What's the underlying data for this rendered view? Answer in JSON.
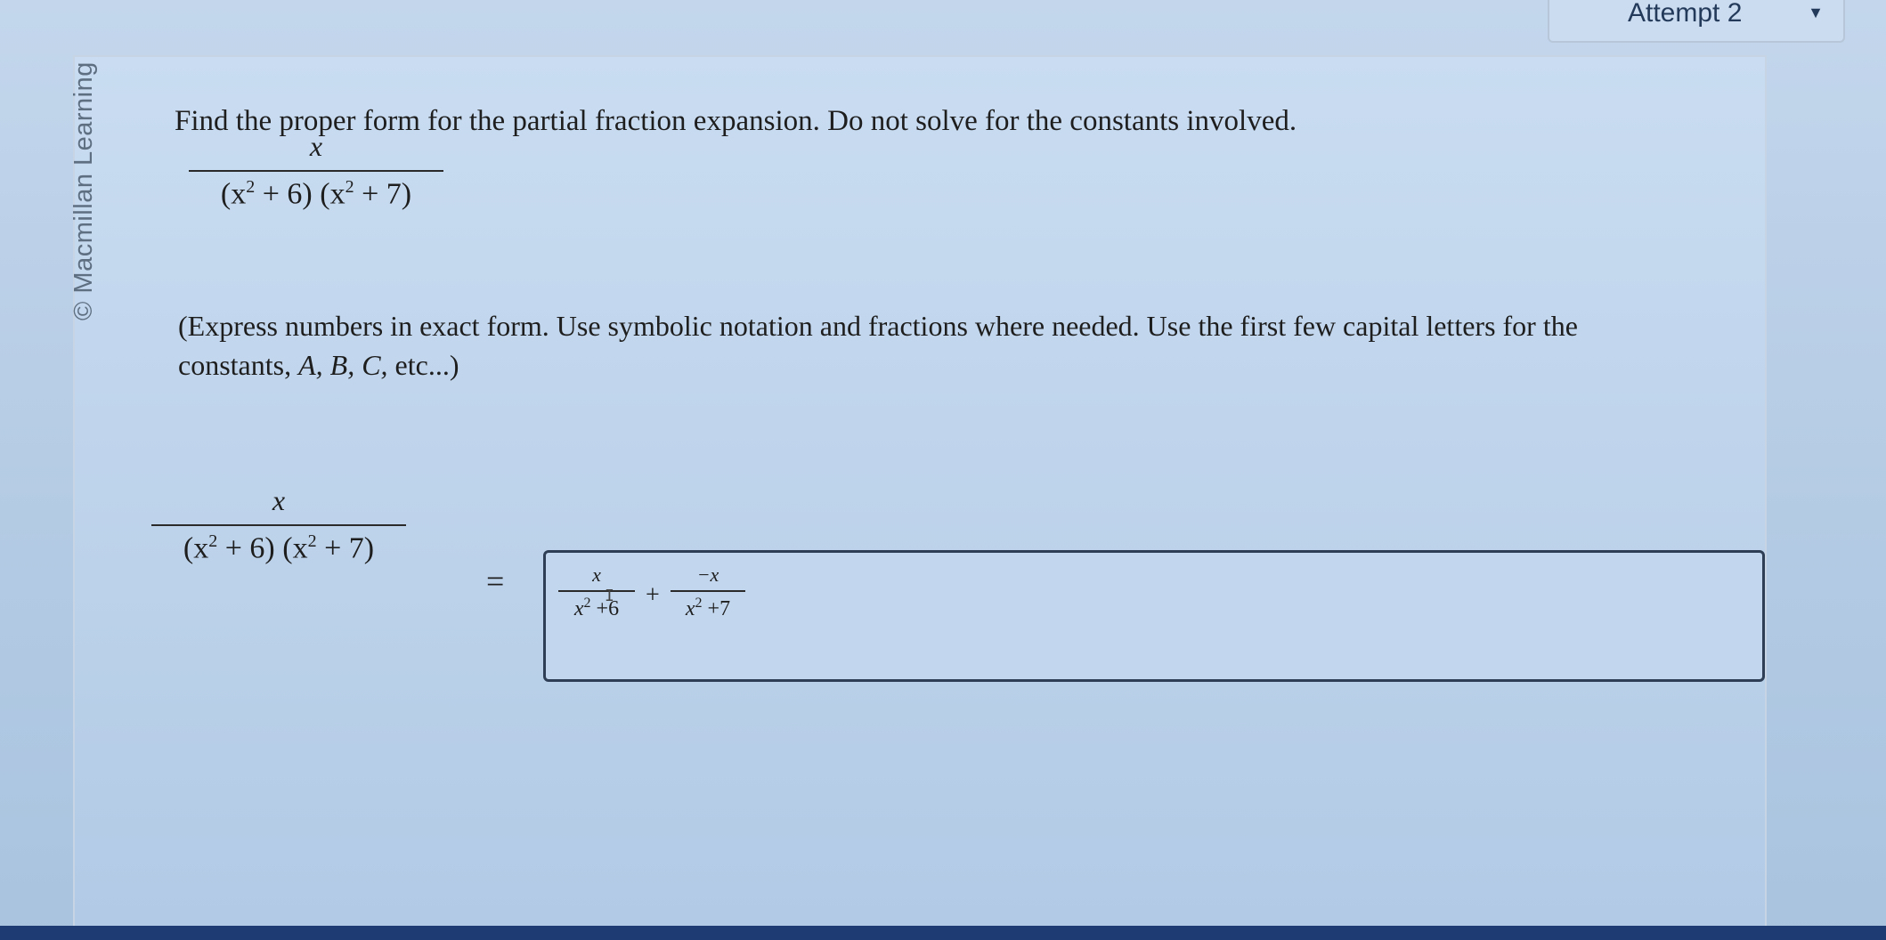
{
  "header": {
    "attempt_label": "Attempt 2"
  },
  "credit": "© Macmillan Learning",
  "question": {
    "prompt": "Find the proper form for the partial fraction expansion. Do not solve for the constants involved.",
    "fraction_numerator": "x",
    "fraction_denominator_part1": "(x",
    "fraction_denominator_exp1": "2",
    "fraction_denominator_part2": " + 6) (x",
    "fraction_denominator_exp2": "2",
    "fraction_denominator_part3": " + 7)",
    "instruction_line1": "(Express numbers in exact form. Use symbolic notation and fractions where needed. Use the first few capital letters for the",
    "instruction_line2_prefix": "constants, ",
    "instruction_constants": "A, B, C,",
    "instruction_line2_suffix": " etc...)"
  },
  "answer": {
    "equals_sign": "=",
    "term1_numerator": "x",
    "term1_denominator_base": "x",
    "term1_denominator_exp": "2",
    "term1_denominator_rest": " +6",
    "operator": "+",
    "term2_numerator": "−x",
    "term2_denominator_base": "x",
    "term2_denominator_exp": "2",
    "term2_denominator_rest": " +7",
    "cursor_glyph": "I"
  },
  "colors": {
    "page_background": "#b9cde3",
    "panel_background": "#c9dcf1",
    "answer_box_border": "#2e3f55",
    "bottom_bar": "#1f3b73"
  }
}
